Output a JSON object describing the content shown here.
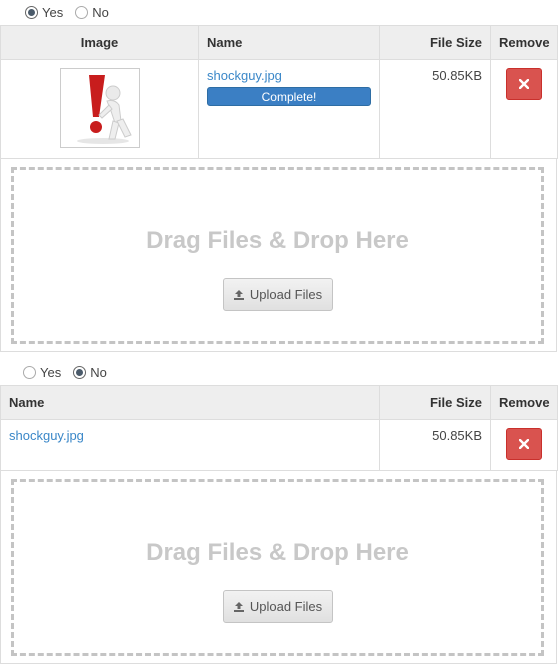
{
  "section1": {
    "radio": {
      "yes": "Yes",
      "no": "No",
      "selected": "Yes"
    },
    "table": {
      "headers": {
        "image": "Image",
        "name": "Name",
        "size": "File Size",
        "remove": "Remove"
      },
      "row": {
        "filename": "shockguy.jpg",
        "status": "Complete!",
        "size": "50.85KB"
      }
    },
    "dropzone": {
      "title": "Drag Files & Drop Here",
      "button": "Upload Files"
    }
  },
  "section2": {
    "radio": {
      "yes": "Yes",
      "no": "No",
      "selected": "No"
    },
    "table": {
      "headers": {
        "name": "Name",
        "size": "File Size",
        "remove": "Remove"
      },
      "row": {
        "filename": "shockguy.jpg",
        "size": "50.85KB"
      }
    },
    "dropzone": {
      "title": "Drag Files & Drop Here",
      "button": "Upload Files"
    }
  },
  "colors": {
    "accent": "#3b7fc4",
    "danger": "#d9534f",
    "link": "#3a87c8"
  }
}
